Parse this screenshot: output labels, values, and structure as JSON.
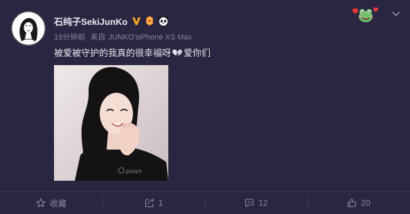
{
  "user": {
    "name": "石纯子SekiJunKo",
    "timestamp": "19分钟前",
    "source_prefix": "来自",
    "source": "JUNKO'siPhone XS Max"
  },
  "post": {
    "text_before": "被爱被守护的我真的很幸福呀",
    "text_after": "爱你们",
    "heart_icon": "heart-icon"
  },
  "photo": {
    "watermark": "@石纯子"
  },
  "footer": {
    "favorite_label": "收藏",
    "repost_count": "1",
    "comment_count": "12",
    "like_count": "20"
  },
  "icons": {
    "verified": "v-badge-icon",
    "level": "fan-badge-icon",
    "panda": "panda-icon",
    "sticker": "frog-sticker-icon",
    "menu": "chevron-down-icon"
  },
  "colors": {
    "background": "#2a2540",
    "verified": "#f5a623",
    "text_primary": "#e6e4ee",
    "text_secondary": "#8c869e"
  }
}
